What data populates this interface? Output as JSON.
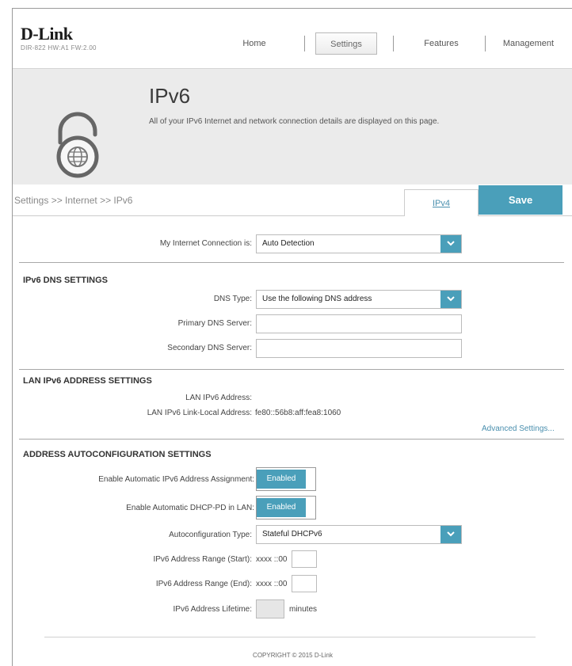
{
  "brand": {
    "logo": "D-Link",
    "subtitle": "DIR-822 HW:A1 FW:2.00"
  },
  "nav": {
    "home": "Home",
    "settings": "Settings",
    "features": "Features",
    "management": "Management"
  },
  "hero": {
    "title": "IPv6",
    "description": "All of your IPv6 Internet and network connection details are displayed on this page."
  },
  "breadcrumb": {
    "text": "Settings >> Internet >> IPv6",
    "ipv4_tab": "IPv4",
    "save": "Save"
  },
  "connection": {
    "label": "My Internet Connection is:",
    "value": "Auto Detection"
  },
  "dns": {
    "title": "IPv6 DNS SETTINGS",
    "type_label": "DNS Type:",
    "type_value": "Use the following DNS address",
    "primary_label": "Primary DNS Server:",
    "primary_value": "",
    "secondary_label": "Secondary DNS Server:",
    "secondary_value": ""
  },
  "lan": {
    "title": "LAN IPv6 ADDRESS SETTINGS",
    "address_label": "LAN IPv6 Address:",
    "address_value": "",
    "link_local_label": "LAN IPv6 Link-Local Address:",
    "link_local_value": "fe80::56b8:aff:fea8:1060",
    "advanced_link": "Advanced Settings..."
  },
  "autoconf": {
    "title": "ADDRESS AUTOCONFIGURATION SETTINGS",
    "auto_assign_label": "Enable Automatic IPv6 Address Assignment:",
    "auto_assign_value": "Enabled",
    "dhcp_pd_label": "Enable Automatic DHCP-PD in LAN:",
    "dhcp_pd_value": "Enabled",
    "type_label": "Autoconfiguration Type:",
    "type_value": "Stateful DHCPv6",
    "range_start_label": "IPv6 Address Range (Start):",
    "range_start_prefix": "xxxx ::00",
    "range_end_label": "IPv6 Address Range (End):",
    "range_end_prefix": "xxxx ::00",
    "lifetime_label": "IPv6 Address Lifetime:",
    "lifetime_unit": "minutes"
  },
  "footer": {
    "copyright": "COPYRIGHT © 2015 D-Link"
  },
  "colors": {
    "accent": "#4a9fba",
    "link": "#4a8fae",
    "hero_bg": "#ebebeb"
  }
}
